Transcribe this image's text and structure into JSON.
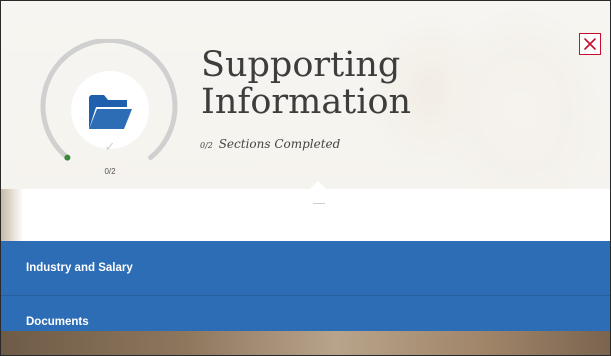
{
  "header": {
    "title_line1": "Supporting",
    "title_line2": "Information",
    "progress_count": "0/2",
    "subtitle_count": "0/2",
    "subtitle_text": "Sections Completed"
  },
  "progress": {
    "completed": 0,
    "total": 2,
    "fraction": 0
  },
  "icons": {
    "main": "folder-icon",
    "check": "check-icon",
    "close": "close-icon"
  },
  "sections": [
    {
      "label": "Industry and Salary"
    },
    {
      "label": "Documents"
    }
  ],
  "colors": {
    "accent_blue": "#2d6db5",
    "close_red": "#c8102e",
    "ring_grey": "#d0d0d0",
    "ring_dot_green": "#3a8a3a"
  }
}
